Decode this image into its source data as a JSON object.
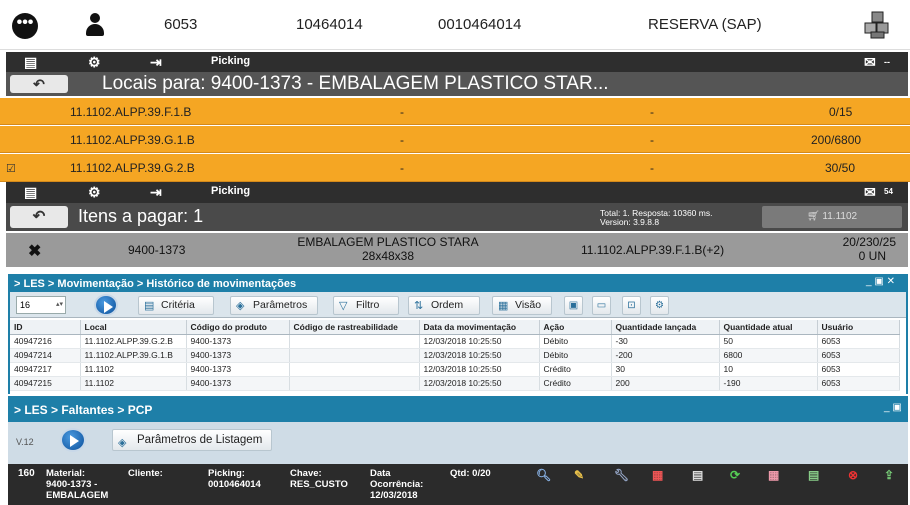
{
  "header": {
    "menu_icon": "ellipsis-icon",
    "user_icon": "user-icon",
    "user_id": "6053",
    "field_1": "10464014",
    "field_2": "0010464014",
    "reservation_label": "RESERVA (SAP)",
    "boxes_icon": "boxes-icon"
  },
  "toolbar1": {
    "icons": [
      "list-icon",
      "gear-icon",
      "exit-icon"
    ],
    "label": "Picking",
    "right_icon": "chat-icon",
    "right_text": "--"
  },
  "locais": {
    "back_icon": "back-arrow-icon",
    "title": "Locais para: 9400-1373 - EMBALAGEM PLASTICO STAR...",
    "rows": [
      {
        "location": "11.1102.ALPP.39.F.1.B",
        "col2": "-",
        "col3": "-",
        "qty": "0/15",
        "checked": false
      },
      {
        "location": "11.1102.ALPP.39.G.1.B",
        "col2": "-",
        "col3": "-",
        "qty": "200/6800",
        "checked": false
      },
      {
        "location": "11.1102.ALPP.39.G.2.B",
        "col2": "-",
        "col3": "-",
        "qty": "30/50",
        "checked": true
      }
    ],
    "row_color": "#f5a623"
  },
  "toolbar2": {
    "label": "Picking",
    "right_text": "54"
  },
  "itens": {
    "title": "Itens a pagar: 1",
    "status_line1": "Total: 1. Resposta: 10360 ms.",
    "status_line2": "Version: 3.9.8.8",
    "cart_button": "11.1102",
    "item": {
      "material": "9400-1373",
      "desc1": "EMBALAGEM PLASTICO STARA",
      "desc2": "28x48x38",
      "location": "11.1102.ALPP.39.F.1.B(+2)",
      "qty1": "20/230/25",
      "qty2": "0 UN"
    }
  },
  "les_hist": {
    "title": "> LES > Movimentação > Histórico de movimentações",
    "page_size": "16",
    "buttons": {
      "criteria": "Critéria",
      "params": "Parâmetros",
      "filter": "Filtro",
      "order": "Ordem",
      "view": "Visão"
    },
    "columns": [
      "ID",
      "Local",
      "Código do produto",
      "Código de rastreabilidade",
      "Data da movimentação",
      "Ação",
      "Quantidade lançada",
      "Quantidade atual",
      "Usuário"
    ],
    "rows": [
      [
        "40947216",
        "11.1102.ALPP.39.G.2.B",
        "9400-1373",
        "",
        "12/03/2018 10:25:50",
        "Débito",
        "-30",
        "50",
        "6053"
      ],
      [
        "40947214",
        "11.1102.ALPP.39.G.1.B",
        "9400-1373",
        "",
        "12/03/2018 10:25:50",
        "Débito",
        "-200",
        "6800",
        "6053"
      ],
      [
        "40947217",
        "11.1102",
        "9400-1373",
        "",
        "12/03/2018 10:25:50",
        "Crédito",
        "30",
        "10",
        "6053"
      ],
      [
        "40947215",
        "11.1102",
        "9400-1373",
        "",
        "12/03/2018 10:25:50",
        "Crédito",
        "200",
        "-190",
        "6053"
      ]
    ]
  },
  "les_pcp": {
    "title": "> LES > Faltantes > PCP",
    "version": "V.12",
    "params_button": "Parâmetros de Listagem",
    "record": {
      "number": "160",
      "material_label": "Material:",
      "material_value": "9400-1373 -",
      "material_value2": "EMBALAGEM",
      "cliente_label": "Cliente:",
      "picking_label": "Picking:",
      "picking_value": "0010464014",
      "chave_label": "Chave:",
      "chave_value": "RES_CUSTO",
      "data_label1": "Data",
      "data_label2": "Ocorrência:",
      "data_value": "12/03/2018",
      "qtd_label": "Qtd: 0/20"
    }
  }
}
